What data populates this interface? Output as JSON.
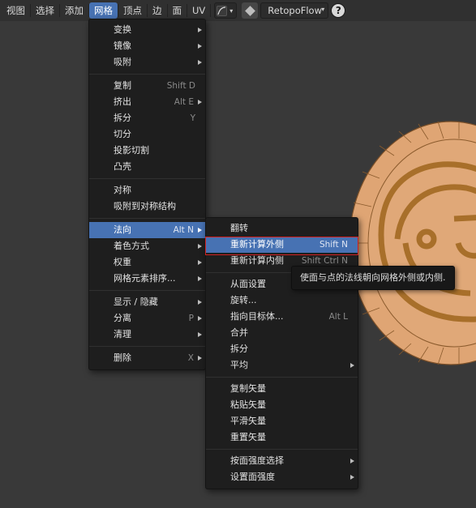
{
  "colors": {
    "accent": "#4772b3",
    "menu_bg": "#1e1e1e",
    "viewport_bg": "#393939",
    "object_fill": "#dfa574",
    "object_relief": "#a86f2a",
    "highlight_border": "#d02020"
  },
  "header": {
    "items": [
      "视图",
      "选择",
      "添加",
      "网格",
      "顶点",
      "边",
      "面",
      "UV"
    ],
    "active": "网格",
    "curve_icon": "curve-icon",
    "addon_icon": "diamond-icon",
    "addon_label": "RetopoFlow",
    "help_icon": "question-icon"
  },
  "mesh_menu": {
    "items": [
      {
        "label": "变换",
        "shortcut": "",
        "submenu": true
      },
      {
        "label": "镜像",
        "shortcut": "",
        "submenu": true
      },
      {
        "label": "吸附",
        "shortcut": "",
        "submenu": true
      },
      {
        "label": "复制",
        "shortcut": "Shift D",
        "submenu": false
      },
      {
        "label": "挤出",
        "shortcut": "Alt E",
        "submenu": true
      },
      {
        "label": "拆分",
        "shortcut": "Y",
        "submenu": false
      },
      {
        "label": "切分",
        "shortcut": "",
        "submenu": false
      },
      {
        "label": "投影切割",
        "shortcut": "",
        "submenu": false
      },
      {
        "label": "凸壳",
        "shortcut": "",
        "submenu": false
      },
      {
        "label": "对称",
        "shortcut": "",
        "submenu": false
      },
      {
        "label": "吸附到对称结构",
        "shortcut": "",
        "submenu": false
      },
      {
        "label": "法向",
        "shortcut": "Alt N",
        "submenu": true
      },
      {
        "label": "着色方式",
        "shortcut": "",
        "submenu": true
      },
      {
        "label": "权重",
        "shortcut": "",
        "submenu": true
      },
      {
        "label": "网格元素排序...",
        "shortcut": "",
        "submenu": true
      },
      {
        "label": "显示 / 隐藏",
        "shortcut": "",
        "submenu": true
      },
      {
        "label": "分离",
        "shortcut": "P",
        "submenu": true
      },
      {
        "label": "清理",
        "shortcut": "",
        "submenu": true
      },
      {
        "label": "删除",
        "shortcut": "X",
        "submenu": true
      }
    ]
  },
  "normals_menu": {
    "items": [
      {
        "label": "翻转",
        "shortcut": "",
        "submenu": false
      },
      {
        "label": "重新计算外侧",
        "shortcut": "Shift N",
        "submenu": false
      },
      {
        "label": "重新计算内侧",
        "shortcut": "Shift Ctrl N",
        "submenu": false
      },
      {
        "label": "从面设置",
        "shortcut": "",
        "submenu": false
      },
      {
        "label": "旋转...",
        "shortcut": "",
        "submenu": false
      },
      {
        "label": "指向目标体...",
        "shortcut": "Alt L",
        "submenu": false
      },
      {
        "label": "合并",
        "shortcut": "",
        "submenu": false
      },
      {
        "label": "拆分",
        "shortcut": "",
        "submenu": false
      },
      {
        "label": "平均",
        "shortcut": "",
        "submenu": true
      },
      {
        "label": "复制矢量",
        "shortcut": "",
        "submenu": false
      },
      {
        "label": "粘贴矢量",
        "shortcut": "",
        "submenu": false
      },
      {
        "label": "平滑矢量",
        "shortcut": "",
        "submenu": false
      },
      {
        "label": "重置矢量",
        "shortcut": "",
        "submenu": false
      },
      {
        "label": "按面强度选择",
        "shortcut": "",
        "submenu": true
      },
      {
        "label": "设置面强度",
        "shortcut": "",
        "submenu": true
      }
    ]
  },
  "tooltip": {
    "text": "使面与点的法线朝向网格外侧或内侧."
  }
}
